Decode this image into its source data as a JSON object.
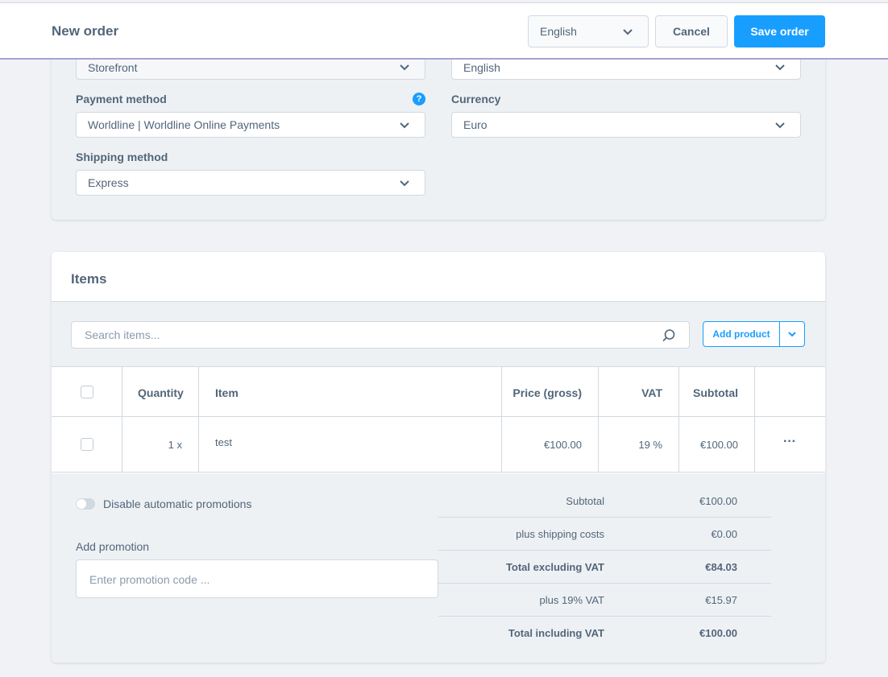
{
  "header": {
    "title": "New order",
    "language": "English",
    "cancel_label": "Cancel",
    "save_label": "Save order"
  },
  "details": {
    "sales_channel_value": "Storefront",
    "language_value": "English",
    "payment_method_label": "Payment method",
    "payment_method_value": "Worldline | Worldline Online Payments",
    "currency_label": "Currency",
    "currency_value": "Euro",
    "shipping_method_label": "Shipping method",
    "shipping_method_value": "Express",
    "help_icon": "?"
  },
  "items": {
    "title": "Items",
    "search_placeholder": "Search items...",
    "add_product_label": "Add product",
    "columns": [
      "Quantity",
      "Item",
      "Price (gross)",
      "VAT",
      "Subtotal"
    ],
    "rows": [
      {
        "quantity": "1 x",
        "item": "test",
        "price": "€100.00",
        "vat": "19 %",
        "subtotal": "€100.00",
        "actions": "···"
      }
    ]
  },
  "summary": {
    "disable_promotions_label": "Disable automatic promotions",
    "add_promotion_label": "Add promotion",
    "promotion_placeholder": "Enter promotion code ...",
    "totals": [
      {
        "label": "Subtotal",
        "value": "€100.00"
      },
      {
        "label": "plus shipping costs",
        "value": "€0.00"
      },
      {
        "label": "Total excluding VAT",
        "value": "€84.03"
      },
      {
        "label": "plus 19% VAT",
        "value": "€15.97"
      },
      {
        "label": "Total including VAT",
        "value": "€100.00"
      }
    ]
  },
  "colors": {
    "accent": "#189eff",
    "text": "#52667a",
    "border": "#d1d9e0"
  }
}
